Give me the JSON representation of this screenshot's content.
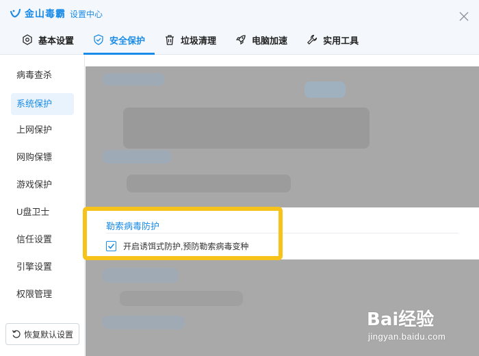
{
  "app": {
    "name": "金山毒霸",
    "subtitle": "设置中心",
    "accent_color": "#1a8be6"
  },
  "tabs": [
    {
      "label": "基本设置",
      "icon": "gear-icon",
      "active": false
    },
    {
      "label": "安全保护",
      "icon": "shield-icon",
      "active": true
    },
    {
      "label": "垃圾清理",
      "icon": "trash-icon",
      "active": false
    },
    {
      "label": "电脑加速",
      "icon": "rocket-icon",
      "active": false
    },
    {
      "label": "实用工具",
      "icon": "wrench-icon",
      "active": false
    }
  ],
  "sidebar": {
    "items": [
      {
        "label": "病毒查杀",
        "active": false
      },
      {
        "label": "系统保护",
        "active": true
      },
      {
        "label": "上网保护",
        "active": false
      },
      {
        "label": "网购保镖",
        "active": false
      },
      {
        "label": "游戏保护",
        "active": false
      },
      {
        "label": "U盘卫士",
        "active": false
      },
      {
        "label": "信任设置",
        "active": false
      },
      {
        "label": "引擎设置",
        "active": false
      },
      {
        "label": "权限管理",
        "active": false
      }
    ],
    "restore_label": "恢复默认设置"
  },
  "content": {
    "section_title": "勒索病毒防护",
    "option_label": "开启诱饵式防护,预防勒索病毒变种",
    "option_checked": true,
    "highlight_color": "#f7c21a"
  },
  "watermark": {
    "logo_text": "Bai经验",
    "url": "jingyan.baidu.com"
  }
}
